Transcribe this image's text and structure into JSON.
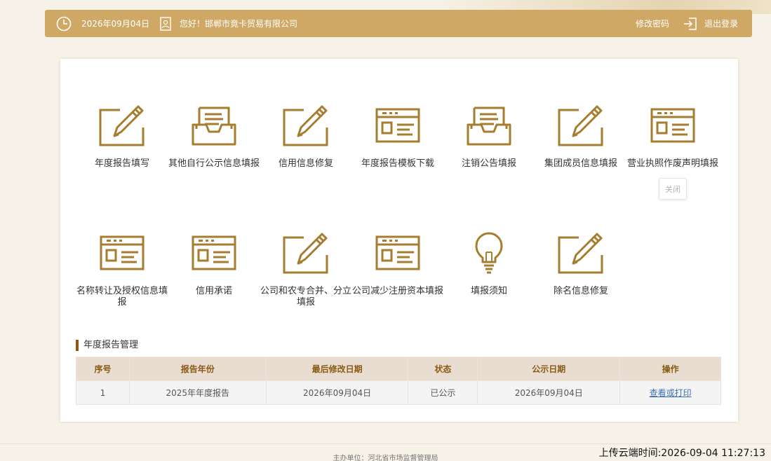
{
  "header": {
    "date": "2026年09月04日",
    "greeting": "您好！邯郸市竟卡贸易有限公司",
    "change_password": "修改密码",
    "logout": "退出登录"
  },
  "tiles": [
    {
      "label": "年度报告填写",
      "icon": "pencil-edit-icon"
    },
    {
      "label": "其他自行公示信息填报",
      "icon": "document-tray-icon"
    },
    {
      "label": "信用信息修复",
      "icon": "pencil-edit-icon"
    },
    {
      "label": "年度报告模板下载",
      "icon": "web-form-icon"
    },
    {
      "label": "注销公告填报",
      "icon": "document-tray-icon"
    },
    {
      "label": "集团成员信息填报",
      "icon": "pencil-edit-icon"
    },
    {
      "label": "营业执照作废声明填报",
      "icon": "web-form-icon"
    },
    {
      "label": "名称转让及授权信息填报",
      "icon": "web-form-icon"
    },
    {
      "label": "信用承诺",
      "icon": "web-form-icon"
    },
    {
      "label": "公司和农专合并、分立填报",
      "icon": "pencil-edit-icon"
    },
    {
      "label": "公司减少注册资本填报",
      "icon": "web-form-icon"
    },
    {
      "label": "填报须知",
      "icon": "lightbulb-icon"
    },
    {
      "label": "除名信息修复",
      "icon": "pencil-edit-icon"
    }
  ],
  "close_button": "关闭",
  "section": {
    "title": "年度报告管理",
    "columns": [
      "序号",
      "报告年份",
      "最后修改日期",
      "状态",
      "公示日期",
      "操作"
    ],
    "rows": [
      {
        "index": "1",
        "year": "2025年年度报告",
        "modified": "2026年09月04日",
        "status": "已公示",
        "publish_date": "2026年09月04日",
        "action": "查看或打印"
      }
    ]
  },
  "footer": {
    "sponsor": "主办单位：河北省市场监督管理局",
    "cloud_time": "上传云端时间:2026-09-04 11:27:13"
  },
  "colors": {
    "accent": "#cfa866",
    "icon": "#a67c2e",
    "link": "#3b6fb4"
  }
}
